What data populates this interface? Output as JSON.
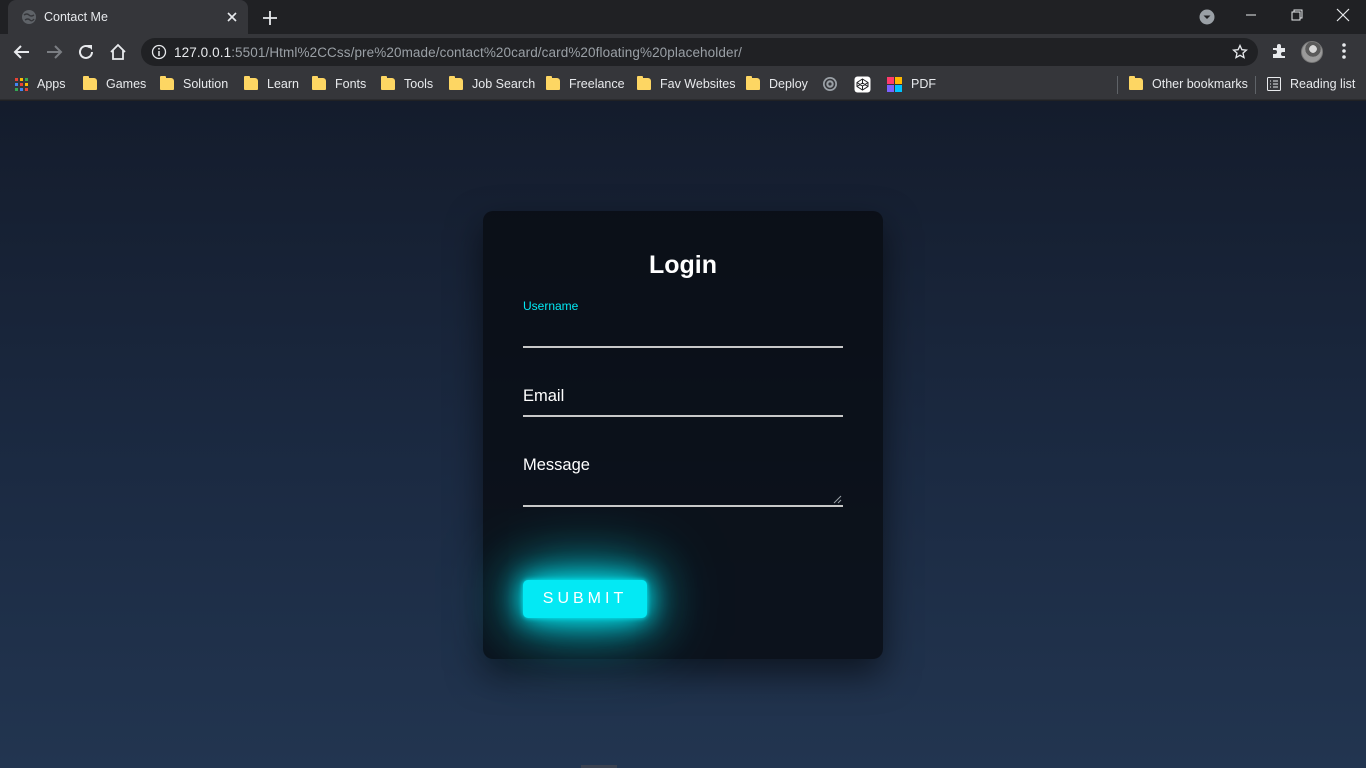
{
  "browser": {
    "tab": {
      "title": "Contact Me",
      "close_icon": "close-icon"
    },
    "new_tab_label": "+",
    "url": {
      "host": "127.0.0.1",
      "rest": ":5501/Html%2CCss/pre%20made/contact%20card/card%20floating%20placeholder/"
    },
    "bookmarks": [
      {
        "label": "Apps",
        "icon": "apps-grid-icon"
      },
      {
        "label": "Games",
        "icon": "folder-icon"
      },
      {
        "label": "Solution",
        "icon": "folder-icon"
      },
      {
        "label": "Learn",
        "icon": "folder-icon"
      },
      {
        "label": "Fonts",
        "icon": "folder-icon"
      },
      {
        "label": "Tools",
        "icon": "folder-icon"
      },
      {
        "label": "Job Search",
        "icon": "folder-icon"
      },
      {
        "label": "Freelance",
        "icon": "folder-icon"
      },
      {
        "label": "Fav Websites",
        "icon": "folder-icon"
      },
      {
        "label": "Deploy",
        "icon": "folder-icon"
      },
      {
        "label": "PDF",
        "icon": "pdf-app-icon"
      }
    ],
    "other_bookmarks": "Other bookmarks",
    "reading_list": "Reading list"
  },
  "form": {
    "title": "Login",
    "username_label": "Username",
    "username_value": "",
    "email_label": "Email",
    "message_label": "Message",
    "submit_label": "SUBMIT"
  },
  "colors": {
    "accent": "#03e9f4",
    "card_bg": "#0b0f16",
    "page_bg_top": "#141c2c",
    "page_bg_bottom": "#223550"
  }
}
